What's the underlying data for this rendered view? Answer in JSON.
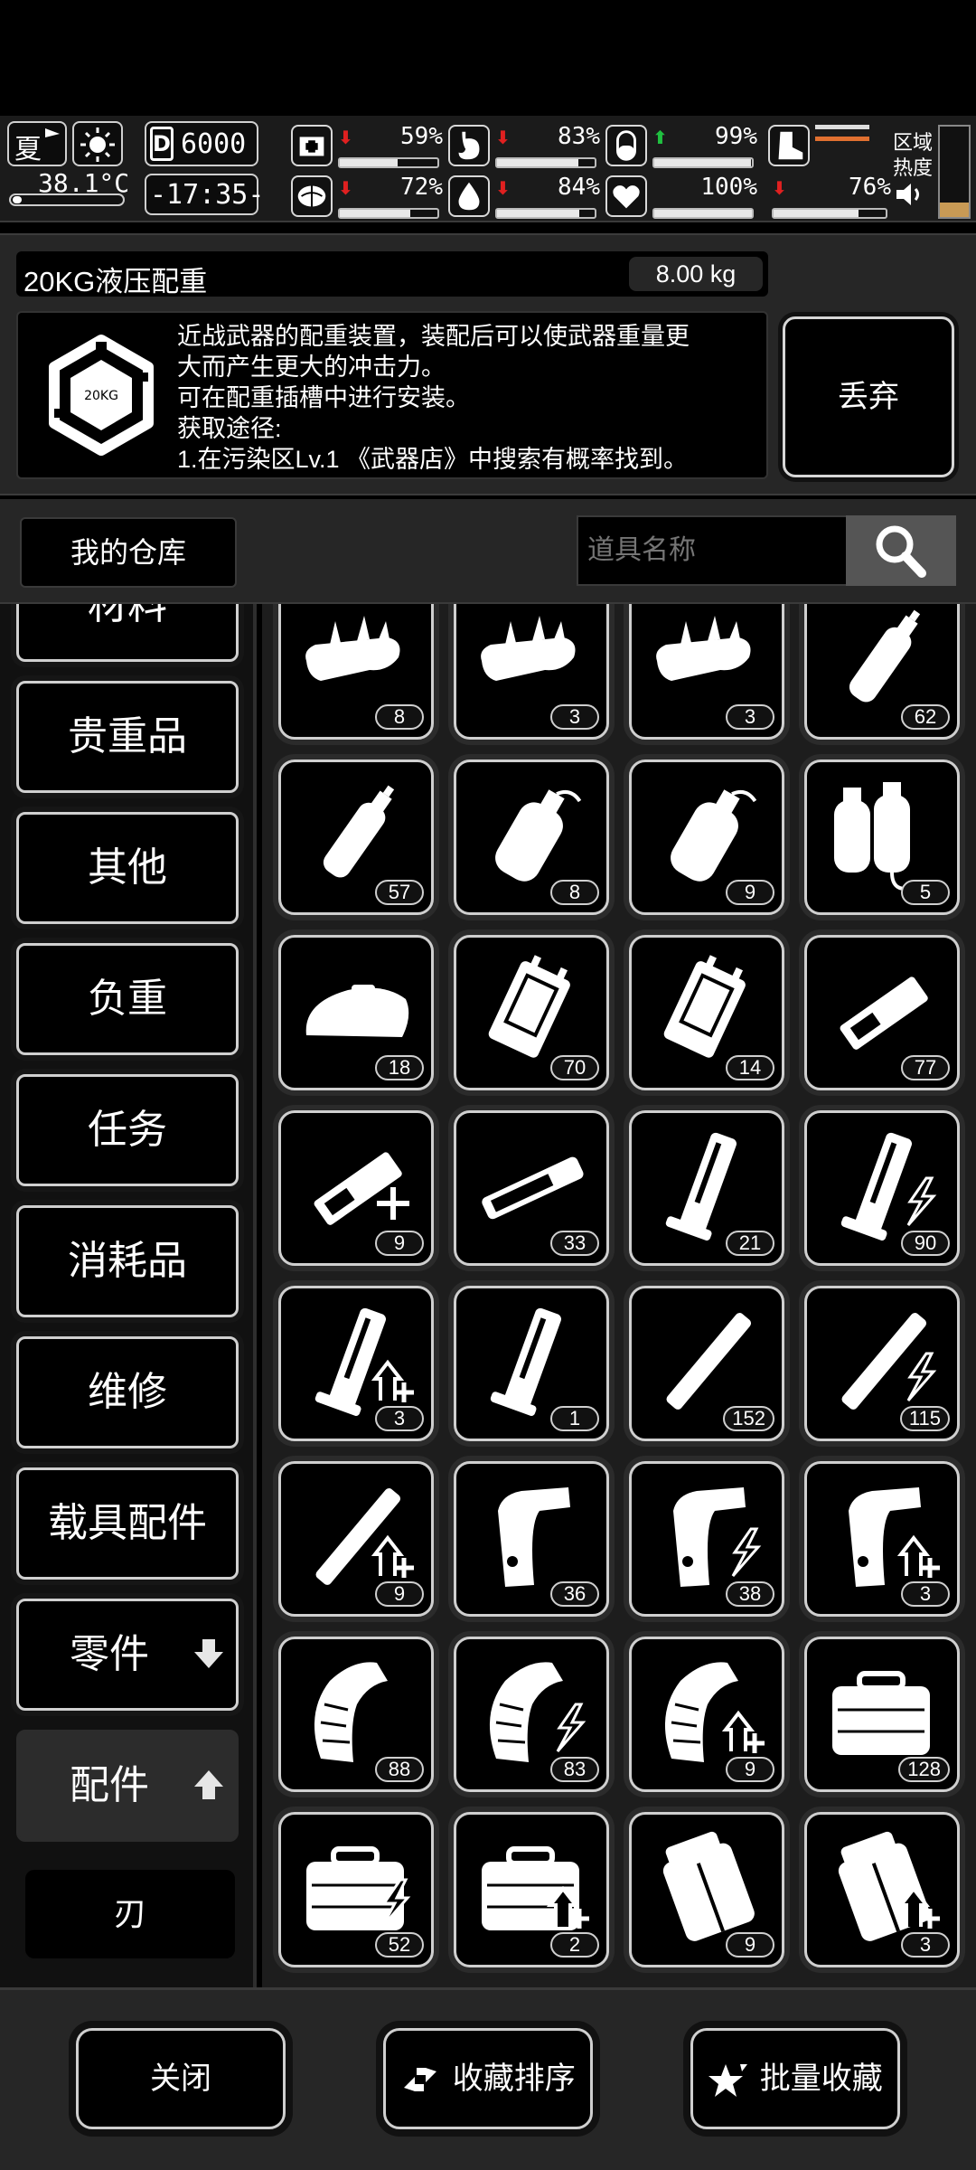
{
  "status": {
    "season": "夏",
    "temperature": "38.1°C",
    "money": "6000",
    "time": "-17:35-",
    "zone_label_1": "区域",
    "zone_label_2": "热度",
    "stats": [
      {
        "id": "health",
        "icon": "medkit-icon",
        "trend": "down",
        "value": "59%",
        "level": 0.59
      },
      {
        "id": "hunger",
        "icon": "stomach-icon",
        "trend": "down",
        "value": "83%",
        "level": 0.83
      },
      {
        "id": "immunity",
        "icon": "pill-icon",
        "trend": "up",
        "value": "99%",
        "level": 0.99
      },
      {
        "id": "mental",
        "icon": "brain-icon",
        "trend": "down",
        "value": "72%",
        "level": 0.72
      },
      {
        "id": "thirst",
        "icon": "water-drop-icon",
        "trend": "down",
        "value": "84%",
        "level": 0.84
      },
      {
        "id": "heart",
        "icon": "heart-icon",
        "trend": "none",
        "value": "100%",
        "level": 1.0
      },
      {
        "id": "stamina",
        "icon": "boot-icon",
        "trend": "down",
        "value": "76%",
        "level": 0.76
      }
    ]
  },
  "detail": {
    "name": "20KG液压配重",
    "weight": "8.00 kg",
    "icon_text": "20KG",
    "description": [
      "近战武器的配重装置，装配后可以使武器重量更",
      "大而产生更大的冲击力。",
      "可在配重插槽中进行安装。",
      "获取途径:",
      "1.在污染区Lv.1 《武器店》中搜索有概率找到。"
    ],
    "discard_label": "丢弃"
  },
  "search": {
    "warehouse_label": "我的仓库",
    "placeholder": "道具名称"
  },
  "categories": [
    {
      "label": "材料",
      "state": "partial"
    },
    {
      "label": "贵重品"
    },
    {
      "label": "其他"
    },
    {
      "label": "负重"
    },
    {
      "label": "任务"
    },
    {
      "label": "消耗品"
    },
    {
      "label": "维修"
    },
    {
      "label": "载具配件"
    },
    {
      "label": "零件",
      "arrow": "down"
    },
    {
      "label": "配件",
      "arrow": "up",
      "state": "active"
    },
    {
      "label": "刃",
      "state": "sub"
    }
  ],
  "items": [
    {
      "icon": "spiked-bar-icon",
      "count": "8"
    },
    {
      "icon": "spiked-bar-icon",
      "count": "3"
    },
    {
      "icon": "spiked-bar-icon",
      "count": "3"
    },
    {
      "icon": "spray-bottle-icon",
      "count": "62"
    },
    {
      "icon": "spray-bottle-icon",
      "count": "57"
    },
    {
      "icon": "gas-canister-icon",
      "count": "8"
    },
    {
      "icon": "gas-canister-icon",
      "count": "9"
    },
    {
      "icon": "gas-tanks-icon",
      "count": "5"
    },
    {
      "icon": "weight-block-icon",
      "count": "18"
    },
    {
      "icon": "battery-pack-icon",
      "count": "70"
    },
    {
      "icon": "battery-pack-icon",
      "count": "14"
    },
    {
      "icon": "gun-rail-icon",
      "count": "77"
    },
    {
      "icon": "gun-rail-icon",
      "count": "9",
      "mod": "plus"
    },
    {
      "icon": "rifle-rail-icon",
      "count": "33"
    },
    {
      "icon": "pistol-magazine-icon",
      "count": "21"
    },
    {
      "icon": "pistol-magazine-icon",
      "count": "90",
      "mod": "bolt"
    },
    {
      "icon": "pistol-magazine-icon",
      "count": "3",
      "mod": "upgrade"
    },
    {
      "icon": "pistol-magazine-icon",
      "count": "1"
    },
    {
      "icon": "stick-magazine-icon",
      "count": "152"
    },
    {
      "icon": "stick-magazine-icon",
      "count": "115",
      "mod": "bolt"
    },
    {
      "icon": "stick-magazine-icon",
      "count": "9",
      "mod": "upgrade"
    },
    {
      "icon": "smg-magazine-icon",
      "count": "36"
    },
    {
      "icon": "smg-magazine-icon",
      "count": "38",
      "mod": "bolt"
    },
    {
      "icon": "smg-magazine-icon",
      "count": "3",
      "mod": "upgrade"
    },
    {
      "icon": "drum-magazine-icon",
      "count": "88"
    },
    {
      "icon": "drum-magazine-icon",
      "count": "83",
      "mod": "bolt"
    },
    {
      "icon": "drum-magazine-icon",
      "count": "9",
      "mod": "upgrade"
    },
    {
      "icon": "ammo-case-icon",
      "count": "128"
    },
    {
      "icon": "ammo-case-icon",
      "count": "52",
      "mod": "bolt"
    },
    {
      "icon": "ammo-case-icon",
      "count": "2",
      "mod": "upgrade"
    },
    {
      "icon": "pouch-icon",
      "count": "9"
    },
    {
      "icon": "pouch-icon",
      "count": "3",
      "mod": "upgrade"
    }
  ],
  "bottom": {
    "close_label": "关闭",
    "sort_label": "收藏排序",
    "batch_label": "批量收藏"
  }
}
